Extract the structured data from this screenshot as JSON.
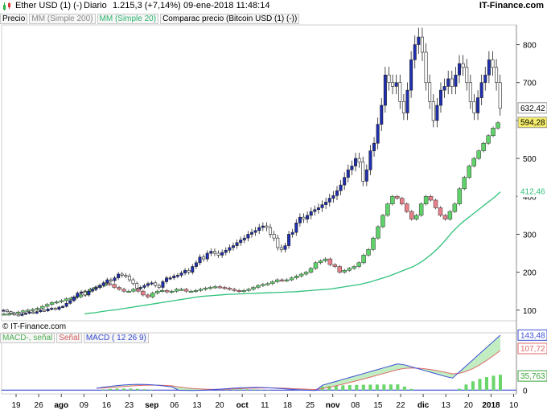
{
  "header": {
    "left": "Ether USD (1) (-)",
    "period": "Diario",
    "quote": "1.215,3 (+7,14%)",
    "datetime": "09-ene-2018 11:48:14",
    "brand": "IT-Finance.com"
  },
  "legend": {
    "price": "Precio",
    "ma200": "MM (Simple 200)",
    "ma20": "MM (Simple 20)",
    "compare": "Comparac precio (Bitcoin USD (1) (-))"
  },
  "copyright": "© IT-Finance.com",
  "macd_legend": {
    "signal_diff": "MACD-, señal",
    "signal": "Señal",
    "macd": "MACD ( 12 26 9)"
  },
  "colors": {
    "bull_candle": "#1e2fb3",
    "bear_candle": "#ffffff",
    "bull_compare": "#5fd36a",
    "bear_compare": "#e8808a",
    "ma20": "#2fc17a",
    "macd_line": "#3b4fd6",
    "signal_line": "#e06a6a",
    "macd_fill": "#a8e6a8",
    "histogram": "#6ad66a",
    "zero_line": "#2233cc"
  },
  "chart_data": {
    "type": "candlestick",
    "xlabels": [
      "19",
      "26",
      "ago",
      "09",
      "16",
      "23",
      "sep",
      "06",
      "13",
      "20",
      "oct",
      "11",
      "18",
      "25",
      "nov",
      "08",
      "15",
      "22",
      "dic",
      "13",
      "20",
      "2018",
      "10"
    ],
    "y_ticks": [
      100,
      200,
      300,
      400,
      500,
      600,
      700,
      800
    ],
    "ylim": [
      72,
      852
    ],
    "price_labels": {
      "last_close": "632,42",
      "compare_value": "594,28",
      "ma20_value": "412,46"
    },
    "ether_close": [
      100,
      96,
      92,
      88,
      86,
      90,
      92,
      95,
      92,
      96,
      100,
      98,
      103,
      105,
      102,
      108,
      110,
      118,
      125,
      135,
      145,
      148,
      140,
      150,
      155,
      160,
      165,
      172,
      180,
      178,
      185,
      195,
      192,
      190,
      180,
      170,
      158,
      160,
      165,
      170,
      172,
      165,
      160,
      175,
      185,
      185,
      190,
      192,
      198,
      205,
      200,
      215,
      225,
      240,
      235,
      250,
      255,
      250,
      245,
      252,
      258,
      265,
      270,
      278,
      285,
      290,
      300,
      305,
      310,
      318,
      322,
      318,
      300,
      290,
      265,
      260,
      270,
      300,
      305,
      330,
      345,
      340,
      350,
      360,
      365,
      370,
      378,
      385,
      395,
      402,
      415,
      430,
      450,
      470,
      480,
      500,
      490,
      440,
      470,
      520,
      540,
      590,
      640,
      720,
      700,
      690,
      700,
      650,
      620,
      680,
      760,
      800,
      820,
      780,
      700,
      650,
      600,
      640,
      680,
      690,
      710,
      690,
      720,
      750,
      740,
      700,
      650,
      620,
      660,
      700,
      720,
      760,
      740,
      700,
      632
    ],
    "bitcoin_compare": [
      90,
      90,
      92,
      95,
      98,
      100,
      102,
      105,
      110,
      115,
      120,
      122,
      125,
      130,
      132,
      135,
      140,
      150,
      155,
      160,
      165,
      170,
      168,
      160,
      155,
      150,
      150,
      155,
      150,
      140,
      135,
      145,
      150,
      152,
      148,
      150,
      155,
      155,
      150,
      150,
      152,
      155,
      158,
      160,
      162,
      160,
      158,
      155,
      152,
      150,
      152,
      155,
      160,
      165,
      168,
      170,
      175,
      180,
      178,
      180,
      185,
      190,
      195,
      200,
      210,
      225,
      230,
      235,
      220,
      215,
      200,
      205,
      210,
      215,
      225,
      245,
      260,
      290,
      320,
      350,
      380,
      400,
      395,
      380,
      360,
      340,
      350,
      380,
      400,
      390,
      370,
      350,
      340,
      360,
      380,
      420,
      450,
      480,
      500,
      520,
      540,
      560,
      580,
      594
    ],
    "ma20": [
      90,
      92,
      93,
      95,
      97,
      99,
      100,
      102,
      104,
      106,
      108,
      110,
      112,
      114,
      116,
      118,
      120,
      122,
      124,
      126,
      128,
      130,
      132,
      134,
      136,
      137,
      138,
      139,
      140,
      141,
      142,
      142,
      143,
      143,
      144,
      144,
      145,
      145,
      146,
      146,
      147,
      147,
      148,
      148,
      149,
      150,
      151,
      152,
      153,
      154,
      155,
      156,
      158,
      160,
      162,
      164,
      166,
      168,
      171,
      174,
      178,
      182,
      186,
      190,
      195,
      200,
      205,
      210,
      215,
      222,
      230,
      240,
      250,
      262,
      275,
      290,
      305,
      318,
      330,
      340,
      350,
      360,
      370,
      380,
      390,
      400,
      412
    ],
    "macd": {
      "zero": 0,
      "last_macd": "143,48",
      "last_signal": "107,72",
      "last_hist": "35,763",
      "ylim": [
        -10,
        150
      ]
    }
  }
}
